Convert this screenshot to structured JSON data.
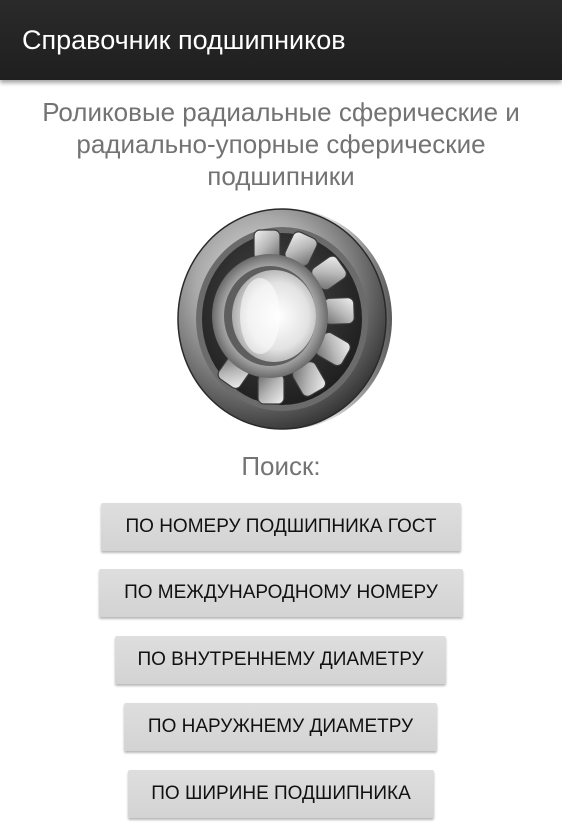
{
  "action_bar": {
    "title": "Справочник подшипников"
  },
  "main": {
    "subtitle_lines": [
      "Роликовые радиальные сферические и",
      "радиально-упорные сферические",
      "подшипники"
    ],
    "image": "spherical-roller-bearing-photo",
    "search_label": "Поиск:",
    "buttons": [
      "ПО НОМЕРУ ПОДШИПНИКА ГОСТ",
      "ПО МЕЖДУНАРОДНОМУ НОМЕРУ",
      "ПО ВНУТРЕННЕМУ ДИАМЕТРУ",
      "ПО НАРУЖНЕМУ ДИАМЕТРУ",
      "ПО ШИРИНЕ ПОДШИПНИКА"
    ]
  },
  "colors": {
    "action_bar": "#222222",
    "button": "#d6d6d6",
    "secondary_text": "#737373"
  }
}
